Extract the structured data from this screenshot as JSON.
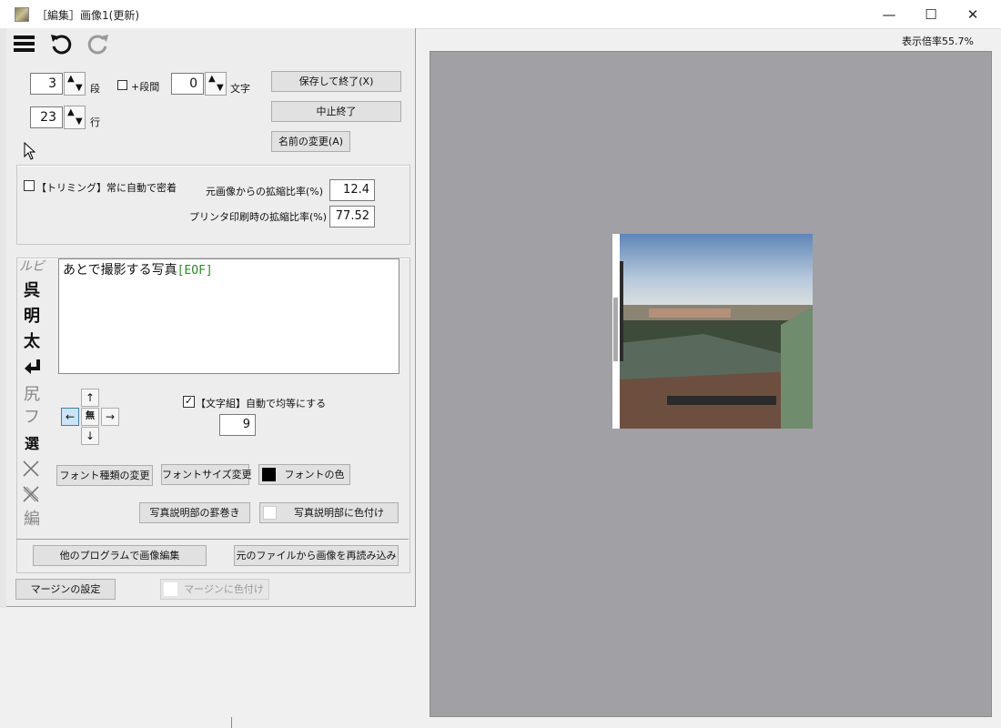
{
  "window": {
    "title": "［編集］画像1(更新)",
    "minimize": "—",
    "maximize": "☐",
    "close": "✕"
  },
  "toolbar": {
    "menu_icon": "menu-icon",
    "undo_icon": "undo-icon",
    "redo_icon": "redo-icon"
  },
  "layout_settings": {
    "columns_value": "3",
    "columns_label": "段",
    "extra_spacing_label": "+段間",
    "chars_value": "0",
    "chars_label": "文字",
    "rows_value": "23",
    "rows_label": "行"
  },
  "actions": {
    "save_exit": "保存して終了(X)",
    "cancel_exit": "中止終了",
    "rename": "名前の変更(A)"
  },
  "trimming": {
    "checkbox_label": "【トリミング】常に自動で密着",
    "scale_from_original_label": "元画像からの拡縮比率(%)",
    "scale_from_original_value": "12.4",
    "print_scale_label": "プリンタ印刷時の拡縮比率(%)",
    "print_scale_value": "77.52"
  },
  "side_tools": [
    "ルビ",
    "呉",
    "明",
    "太",
    "改行",
    "尻",
    "フ",
    "選",
    "削除",
    "全削除",
    "編"
  ],
  "caption": {
    "text": "あとで撮影する写真",
    "eof": "[EOF]"
  },
  "position_pad": {
    "up": "↑",
    "left": "←",
    "center": "無",
    "right": "→",
    "down": "↓"
  },
  "char_layout": {
    "checkbox_label": "【文字組】自動で均等にする",
    "checked": true,
    "value": "9"
  },
  "font_buttons": {
    "font_type": "フォント種類の変更",
    "font_size": "フォントサイズ変更",
    "font_color": "フォントの色",
    "font_color_swatch": "#000000"
  },
  "caption_buttons": {
    "wrap": "写真説明部の罫巻き",
    "color": "写真説明部に色付け",
    "color_swatch": "#ffffff"
  },
  "image_buttons": {
    "edit_external": "他のプログラムで画像編集",
    "reload": "元のファイルから画像を再読み込み"
  },
  "margin": {
    "settings": "マージンの設定",
    "color": "マージンに色付け"
  },
  "preview": {
    "zoom_label": "表示倍率55.7%",
    "background": "#a1a0a5"
  }
}
